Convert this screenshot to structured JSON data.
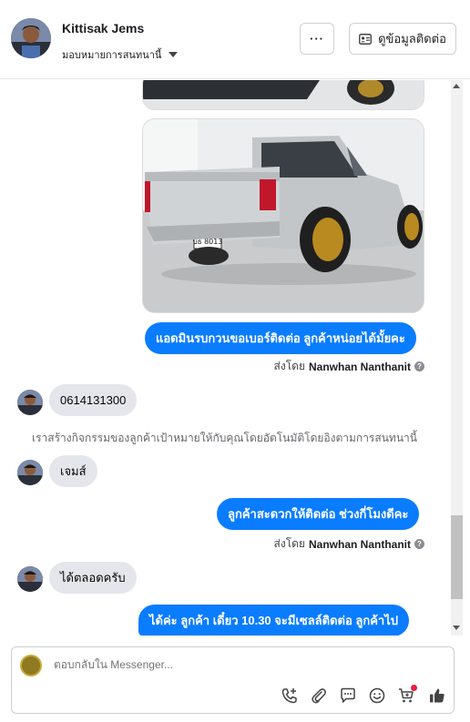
{
  "header": {
    "name": "Kittisak Jems",
    "assign_label": "มอบหมายการสนทนานี้",
    "more_label": "···",
    "contact_button_label": "ดูข้อมูลติดต่อ"
  },
  "messages": {
    "out_1": "แอดมินรบกวนขอเบอร์ติดต่อ ลูกค้าหน่อยได้มั้ยคะ",
    "sent_by_1_prefix": "ส่งโดย",
    "sent_by_1_name": "Nanwhan Nanthanit",
    "in_1": "0614131300",
    "system_note": "เราสร้างกิจกรรมของลูกค้าเป้าหมายให้กับคุณโดยอัตโนมัติโดยอิงตามการสนทนานี้",
    "in_2": "เจมส์",
    "out_2": "ลูกค้าสะดวกให้ติดต่อ ช่วงกี่โมงดีคะ",
    "sent_by_2_prefix": "ส่งโดย",
    "sent_by_2_name": "Nanwhan Nanthanit",
    "in_3": "ได้ตลอดครับ",
    "out_3": "ได้ค่ะ ลูกค้า เดี๋ยว 10.30 จะมีเซลล์ติดต่อ ลูกค้าไป",
    "plate_text": "บธ 8013"
  },
  "composer": {
    "placeholder": "ตอบกลับใน Messenger..."
  },
  "colors": {
    "accent": "#0a7cff",
    "incoming_bubble": "#e4e6eb",
    "badge": "#e41e3f"
  },
  "icons": [
    "phone-plus-icon",
    "paperclip-icon",
    "chat-bubble-icon",
    "emoji-icon",
    "cart-icon",
    "thumbs-up-icon"
  ]
}
